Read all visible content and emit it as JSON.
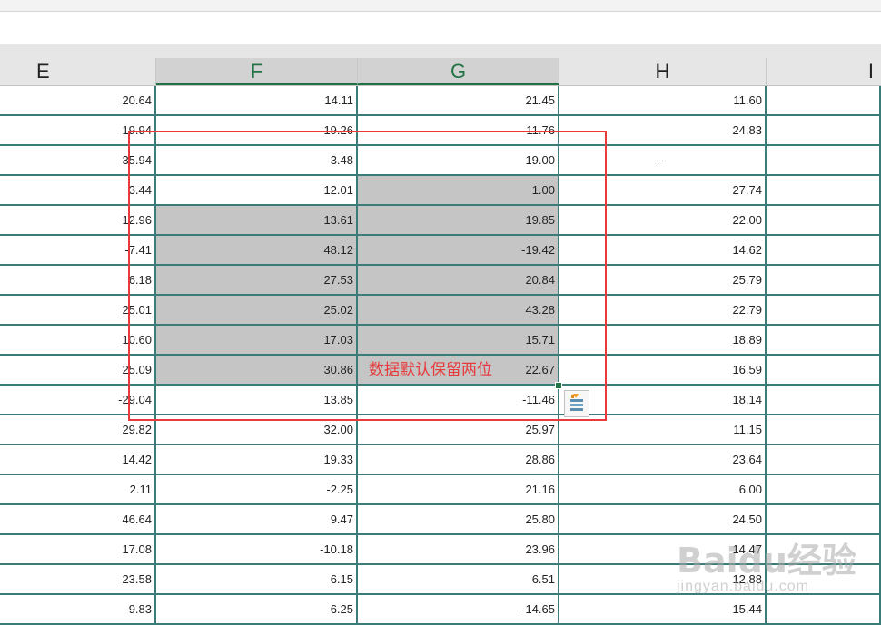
{
  "columns": [
    {
      "label": "E",
      "selected": false
    },
    {
      "label": "F",
      "selected": true
    },
    {
      "label": "G",
      "selected": true
    },
    {
      "label": "H",
      "selected": false
    },
    {
      "label": "I",
      "selected": false
    }
  ],
  "rows": [
    {
      "E": "20.64",
      "F": "14.11",
      "G": "21.45",
      "H": "11.60",
      "hl_F": false,
      "hl_G": false
    },
    {
      "E": "19.94",
      "F": "19.26",
      "G": "11.76",
      "H": "24.83",
      "hl_F": false,
      "hl_G": false
    },
    {
      "E": "35.94",
      "F": "3.48",
      "G": "19.00",
      "H": "--",
      "hl_F": false,
      "hl_G": false
    },
    {
      "E": "3.44",
      "F": "12.01",
      "G": "1.00",
      "H": "27.74",
      "hl_F": false,
      "hl_G": true
    },
    {
      "E": "12.96",
      "F": "13.61",
      "G": "19.85",
      "H": "22.00",
      "hl_F": true,
      "hl_G": true
    },
    {
      "E": "-7.41",
      "F": "48.12",
      "G": "-19.42",
      "H": "14.62",
      "hl_F": true,
      "hl_G": true
    },
    {
      "E": "6.18",
      "F": "27.53",
      "G": "20.84",
      "H": "25.79",
      "hl_F": true,
      "hl_G": true
    },
    {
      "E": "25.01",
      "F": "25.02",
      "G": "43.28",
      "H": "22.79",
      "hl_F": true,
      "hl_G": true
    },
    {
      "E": "10.60",
      "F": "17.03",
      "G": "15.71",
      "H": "18.89",
      "hl_F": true,
      "hl_G": true
    },
    {
      "E": "25.09",
      "F": "30.86",
      "G": "22.67",
      "H": "16.59",
      "hl_F": true,
      "hl_G": true
    },
    {
      "E": "-29.04",
      "F": "13.85",
      "G": "-11.46",
      "H": "18.14",
      "hl_F": false,
      "hl_G": false
    },
    {
      "E": "29.82",
      "F": "32.00",
      "G": "25.97",
      "H": "11.15",
      "hl_F": false,
      "hl_G": false
    },
    {
      "E": "14.42",
      "F": "19.33",
      "G": "28.86",
      "H": "23.64",
      "hl_F": false,
      "hl_G": false
    },
    {
      "E": "2.11",
      "F": "-2.25",
      "G": "21.16",
      "H": "6.00",
      "hl_F": false,
      "hl_G": false
    },
    {
      "E": "46.64",
      "F": "9.47",
      "G": "25.80",
      "H": "24.50",
      "hl_F": false,
      "hl_G": false
    },
    {
      "E": "17.08",
      "F": "-10.18",
      "G": "23.96",
      "H": "14.47",
      "hl_F": false,
      "hl_G": false
    },
    {
      "E": "23.58",
      "F": "6.15",
      "G": "6.51",
      "H": "12.88",
      "hl_F": false,
      "hl_G": false
    },
    {
      "E": "-9.83",
      "F": "6.25",
      "G": "-14.65",
      "H": "15.44",
      "hl_F": false,
      "hl_G": false
    }
  ],
  "annotation": {
    "text": "数据默认保留两位"
  },
  "quick_analysis": {
    "icon": "quick-analysis-icon"
  },
  "watermark": {
    "text": "Baidu经验",
    "sub": "jingyan.baidu.com"
  },
  "colors": {
    "grid_line": "#3a7d78",
    "highlight": "#c5c5c5",
    "annotation": "#e83a3a",
    "header_selected_text": "#217346"
  }
}
